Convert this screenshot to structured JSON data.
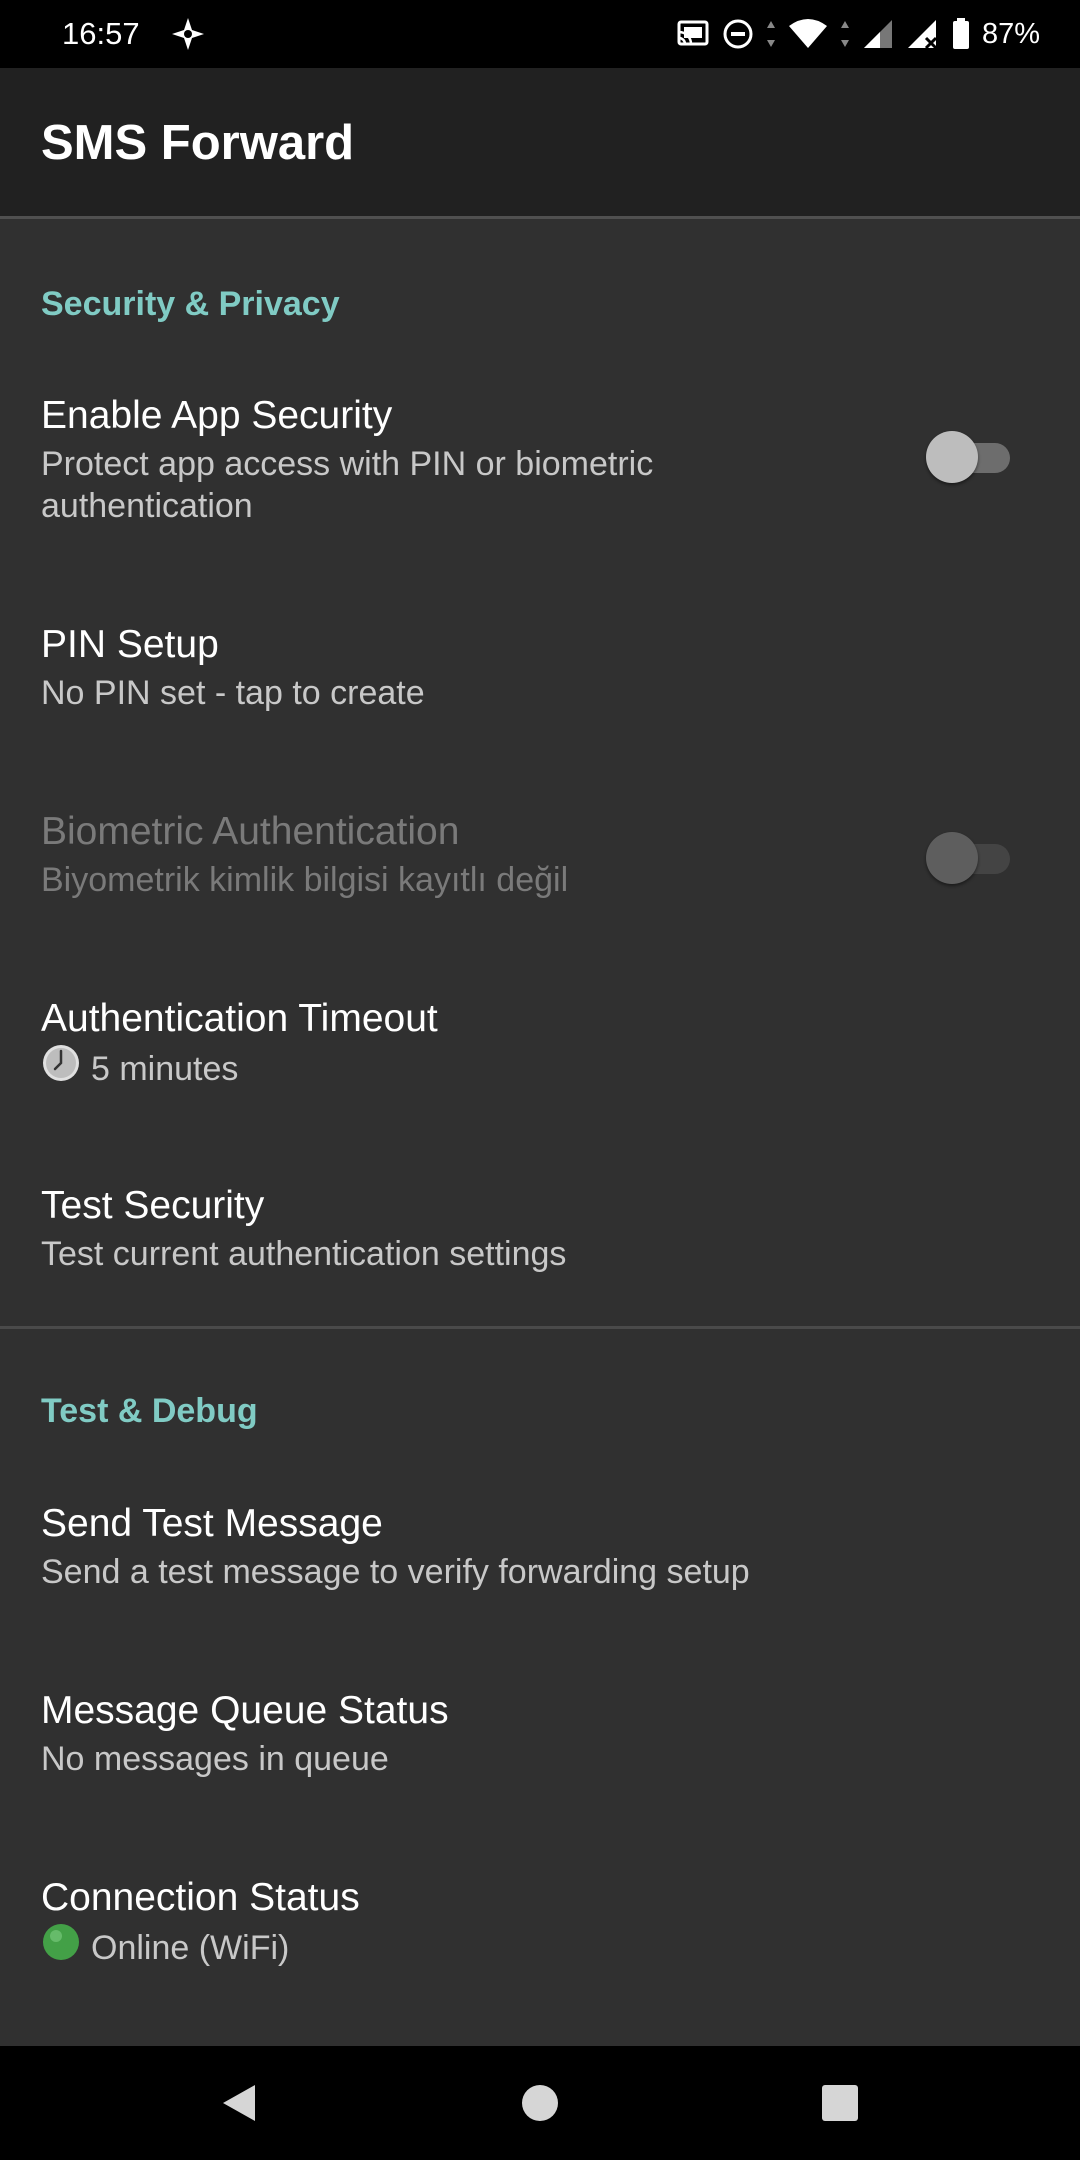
{
  "status_bar": {
    "time": "16:57",
    "battery": "87%"
  },
  "app_bar": {
    "title": "SMS Forward"
  },
  "sections": {
    "security": {
      "title": "Security & Privacy",
      "items": {
        "app_security": {
          "title": "Enable App Security",
          "summary": "Protect app access with PIN or biometric authentication",
          "checked": false
        },
        "pin_setup": {
          "title": "PIN Setup",
          "summary": "No PIN set - tap to create"
        },
        "biometric": {
          "title": "Biometric Authentication",
          "summary": "Biyometrik kimlik bilgisi kayıtlı değil",
          "checked": false,
          "enabled": false
        },
        "timeout": {
          "title": "Authentication Timeout",
          "icon": "clock-icon",
          "summary": "5 minutes"
        },
        "test_security": {
          "title": "Test Security",
          "summary": "Test current authentication settings"
        }
      }
    },
    "debug": {
      "title": "Test & Debug",
      "items": {
        "send_test": {
          "title": "Send Test Message",
          "summary": "Send a test message to verify forwarding setup"
        },
        "queue_status": {
          "title": "Message Queue Status",
          "summary": "No messages in queue"
        },
        "connection_status": {
          "title": "Connection Status",
          "icon": "green-circle-icon",
          "summary": "Online (WiFi)"
        }
      }
    }
  },
  "colors": {
    "accent": "#80cbc4",
    "background": "#303030",
    "app_bar": "#212121",
    "online": "#43a047"
  }
}
